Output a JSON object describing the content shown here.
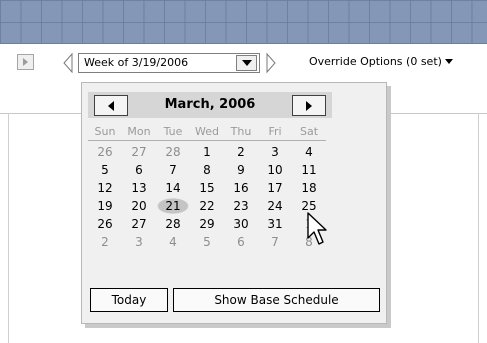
{
  "toolbar": {
    "week_value": "Week of 3/19/2006",
    "override_label": "Override Options (0 set)"
  },
  "calendar": {
    "title": "March, 2006",
    "weekdays": [
      "Sun",
      "Mon",
      "Tue",
      "Wed",
      "Thu",
      "Fri",
      "Sat"
    ],
    "weeks": [
      [
        "26",
        "27",
        "28",
        "1",
        "2",
        "3",
        "4"
      ],
      [
        "5",
        "6",
        "7",
        "8",
        "9",
        "10",
        "11"
      ],
      [
        "12",
        "13",
        "14",
        "15",
        "16",
        "17",
        "18"
      ],
      [
        "19",
        "20",
        "21",
        "22",
        "23",
        "24",
        "25"
      ],
      [
        "26",
        "27",
        "28",
        "29",
        "30",
        "31",
        "1"
      ],
      [
        "2",
        "3",
        "4",
        "5",
        "6",
        "7",
        "8"
      ]
    ],
    "today_label": "Today",
    "base_schedule_label": "Show Base Schedule"
  },
  "colors": {
    "header_band": "#8597b6",
    "popup_bg": "#f0f0f0",
    "muted_text": "#8e8e8e"
  }
}
